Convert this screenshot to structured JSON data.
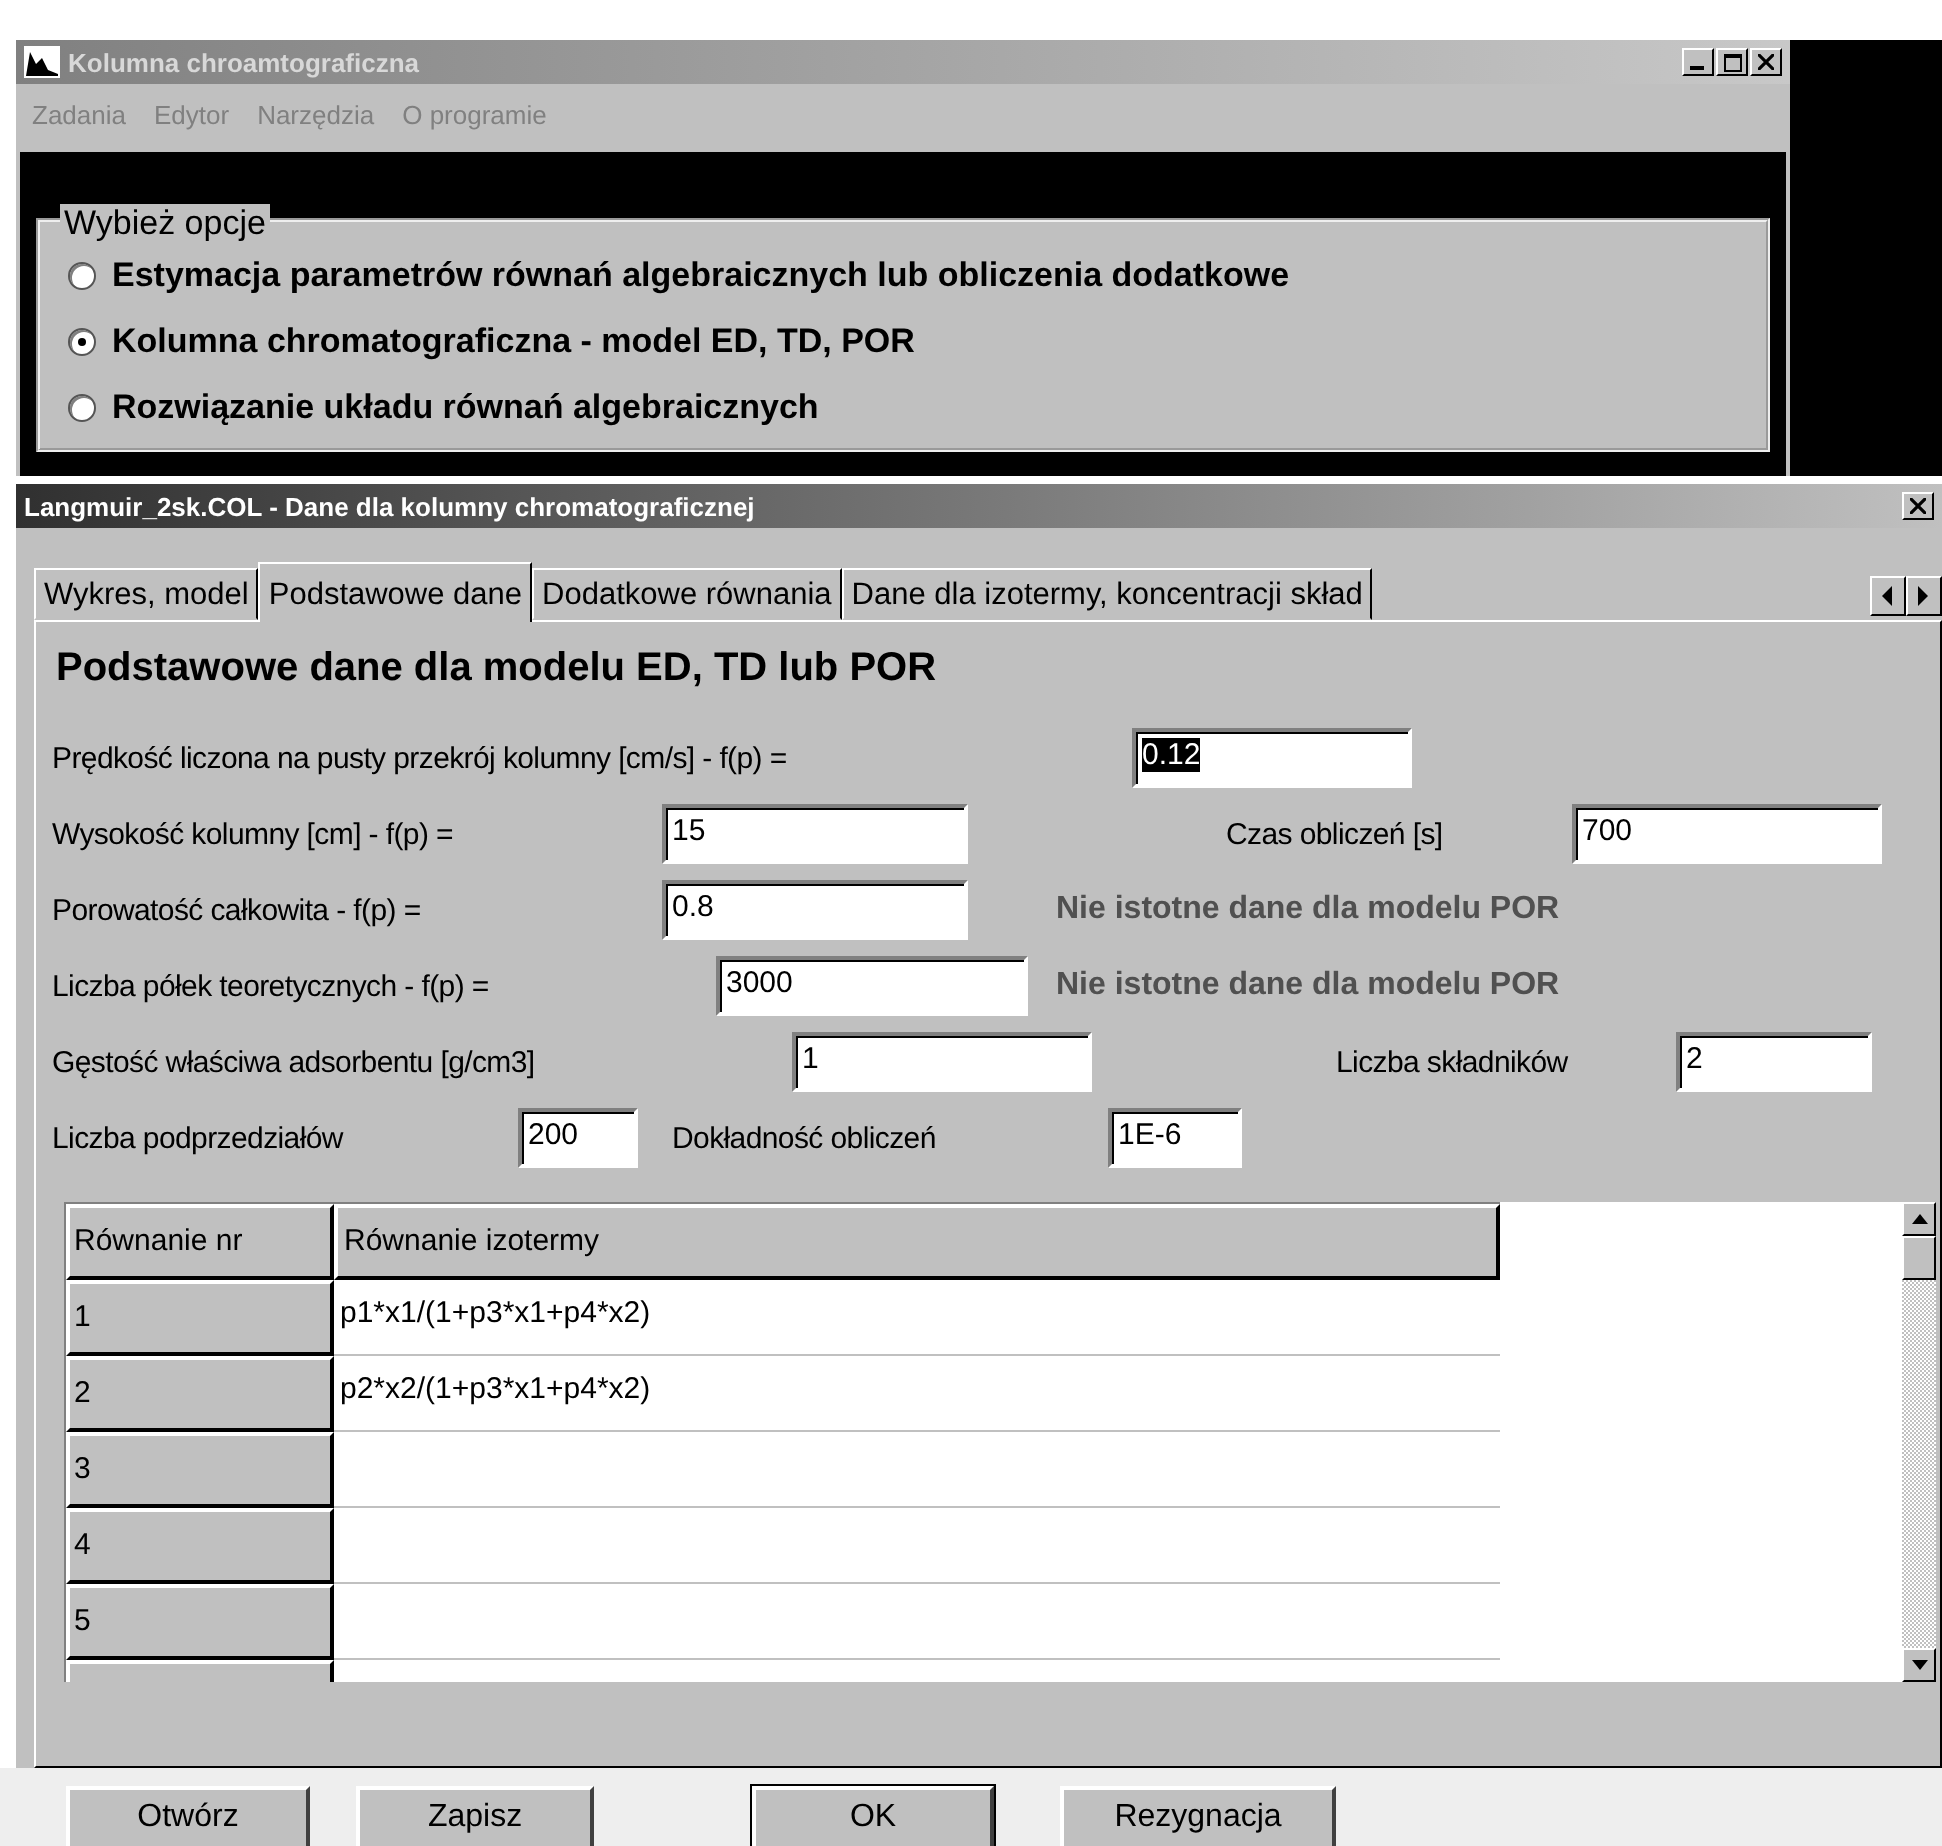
{
  "main_window": {
    "title": "Kolumna chroamtograficzna",
    "menu": [
      "Zadania",
      "Edytor",
      "Narzędzia",
      "O programie"
    ],
    "options_group": {
      "legend": "Wybież opcje",
      "options": [
        {
          "label": "Estymacja parametrów równań algebraicznych lub obliczenia dodatkowe",
          "selected": false
        },
        {
          "label": "Kolumna chromatograficzna - model ED, TD, POR",
          "selected": true
        },
        {
          "label": "Rozwiązanie układu równań algebraicznych",
          "selected": false
        }
      ]
    }
  },
  "dialog": {
    "title": "Langmuir_2sk.COL - Dane dla kolumny chromatograficznej",
    "tabs": [
      {
        "label": "Wykres, model",
        "selected": false
      },
      {
        "label": "Podstawowe dane",
        "selected": true
      },
      {
        "label": "Dodatkowe równania",
        "selected": false
      },
      {
        "label": "Dane dla izotermy, koncentracji skład",
        "selected": false
      }
    ],
    "heading": "Podstawowe dane dla modelu ED, TD lub POR",
    "rows": [
      [
        {
          "kind": "field",
          "label": "Prędkość liczona na pusty przekrój kolumny [cm/s] - f(p) =",
          "value": "0.12",
          "focused": true
        }
      ],
      [
        {
          "kind": "field",
          "label": "Wysokość kolumny [cm] - f(p) =",
          "value": "15",
          "focused": false
        },
        {
          "kind": "field",
          "label": "Czas obliczeń [s]",
          "value": "700",
          "focused": false
        }
      ],
      [
        {
          "kind": "field",
          "label": "Porowatość całkowita - f(p) =",
          "value": "0.8",
          "focused": false
        },
        {
          "kind": "note",
          "text": "Nie istotne dane dla modelu POR"
        }
      ],
      [
        {
          "kind": "field",
          "label": "Liczba półek teoretycznych - f(p) =",
          "value": "3000",
          "focused": false
        },
        {
          "kind": "note",
          "text": "Nie istotne dane dla modelu POR"
        }
      ],
      [
        {
          "kind": "field",
          "label": "Gęstość właściwa adsorbentu [g/cm3]",
          "value": "1",
          "focused": false
        },
        {
          "kind": "field",
          "label": "Liczba składników",
          "value": "2",
          "focused": false
        }
      ],
      [
        {
          "kind": "field",
          "label": "Liczba podprzedziałów",
          "value": "200",
          "focused": false
        },
        {
          "kind": "field",
          "label": "Dokładność obliczeń",
          "value": "1E-6",
          "focused": false
        }
      ]
    ],
    "table": {
      "columns": [
        "Równanie nr",
        "Równanie izotermy"
      ],
      "rows": [
        {
          "nr": "1",
          "equation": "p1*x1/(1+p3*x1+p4*x2)"
        },
        {
          "nr": "2",
          "equation": "p2*x2/(1+p3*x1+p4*x2)"
        },
        {
          "nr": "3"
        },
        {
          "nr": "4"
        },
        {
          "nr": "5"
        }
      ]
    },
    "buttons": [
      {
        "label": "Otwórz",
        "default": false
      },
      {
        "label": "Zapisz",
        "default": false
      },
      {
        "label": "OK",
        "default": true
      },
      {
        "label": "Rezygnacja",
        "default": false
      }
    ]
  }
}
